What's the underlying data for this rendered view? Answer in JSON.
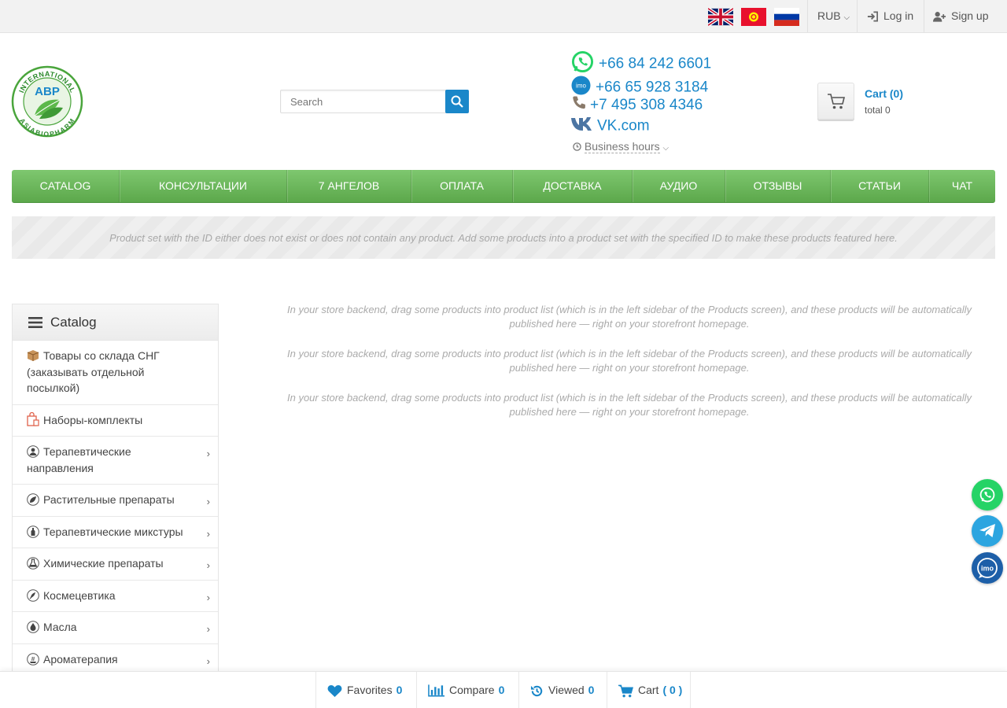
{
  "topbar": {
    "flags": [
      "uk-flag",
      "kyrgyzstan-flag",
      "russia-flag"
    ],
    "currency": "RUB",
    "login": "Log in",
    "signup": "Sign up"
  },
  "logo": {
    "top_text": "INTERNATIONAL",
    "center_text": "ABP",
    "bottom_text": "ASIABIOPHARM"
  },
  "search": {
    "placeholder": "Search"
  },
  "contacts": {
    "whatsapp": "+66 84 242 6601",
    "imo": "+66 65 928 3184",
    "phone": "+7 495 308 4346",
    "vk": "VK.com",
    "business_hours": "Business hours",
    "imo_icon_text": "imo"
  },
  "cart": {
    "title": "Cart (0)",
    "total": "total 0"
  },
  "menu": [
    {
      "label": "CATALOG"
    },
    {
      "label": "КОНСУЛЬТАЦИИ"
    },
    {
      "label": "7 АНГЕЛОВ"
    },
    {
      "label": "ОПЛАТА"
    },
    {
      "label": "ДОСТАВКА"
    },
    {
      "label": "АУДИО"
    },
    {
      "label": "ОТЗЫВЫ"
    },
    {
      "label": "СТАТЬИ"
    },
    {
      "label": "ЧАТ"
    }
  ],
  "notice": "Product set with the ID either does not exist or does not contain any product. Add some products into a product set with the specified ID to make these products featured here.",
  "sidebar": {
    "title": "Catalog",
    "items": [
      {
        "label": "Товары со склада СНГ (заказывать отдельной посылкой)",
        "icon": "box-icon",
        "has_children": false
      },
      {
        "label": "Наборы-комплекты",
        "icon": "gift-set-icon",
        "has_children": false
      },
      {
        "label": "Терапевтические направления",
        "icon": "doctor-icon",
        "has_children": true
      },
      {
        "label": "Растительные препараты",
        "icon": "leaf-icon",
        "has_children": true
      },
      {
        "label": "Терапевтические микстуры",
        "icon": "bottle-icon",
        "has_children": true
      },
      {
        "label": "Химические препараты",
        "icon": "flask-icon",
        "has_children": true
      },
      {
        "label": "Космецевтика",
        "icon": "cosmetics-icon",
        "has_children": true
      },
      {
        "label": "Масла",
        "icon": "oil-drop-icon",
        "has_children": true
      },
      {
        "label": "Ароматерапия",
        "icon": "aroma-icon",
        "has_children": true
      }
    ]
  },
  "main_messages": [
    "In your store backend, drag some products into product list (which is in the left sidebar of the Products screen), and these products will be automatically published here — right on your storefront homepage.",
    "In your store backend, drag some products into product list (which is in the left sidebar of the Products screen), and these products will be automatically published here — right on your storefront homepage.",
    "In your store backend, drag some products into product list (which is in the left sidebar of the Products screen), and these products will be automatically published here — right on your storefront homepage."
  ],
  "floating": [
    "whatsapp-icon",
    "telegram-icon",
    "imo-icon"
  ],
  "bottombar": {
    "favorites": {
      "label": "Favorites",
      "count": "0"
    },
    "compare": {
      "label": "Compare",
      "count": "0"
    },
    "viewed": {
      "label": "Viewed",
      "count": "0"
    },
    "cart": {
      "label": "Cart",
      "count": "( 0 )"
    }
  },
  "colors": {
    "accent": "#1a87c9",
    "menu_green": "#6bb85b",
    "whatsapp": "#25d366",
    "telegram": "#2ca5e0",
    "imo": "#1d5fa8"
  }
}
